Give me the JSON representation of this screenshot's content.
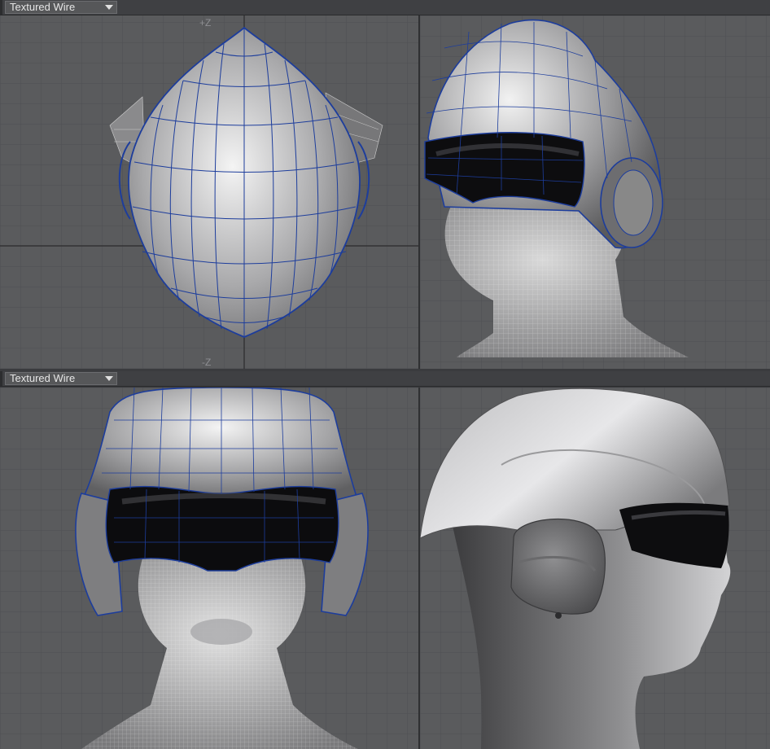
{
  "top_panel": {
    "view_mode": "Textured Wire",
    "axis_top": "+Z",
    "axis_bottom": "-Z"
  },
  "bottom_panel": {
    "view_mode": "Textured Wire"
  },
  "icons": {
    "dropdown": "chevron-down-icon"
  },
  "colors": {
    "background": "#5a5b5d",
    "grid": "#4c4d50",
    "wire_blue": "#1d3d9c",
    "wire_face": "#d8d8d8"
  }
}
